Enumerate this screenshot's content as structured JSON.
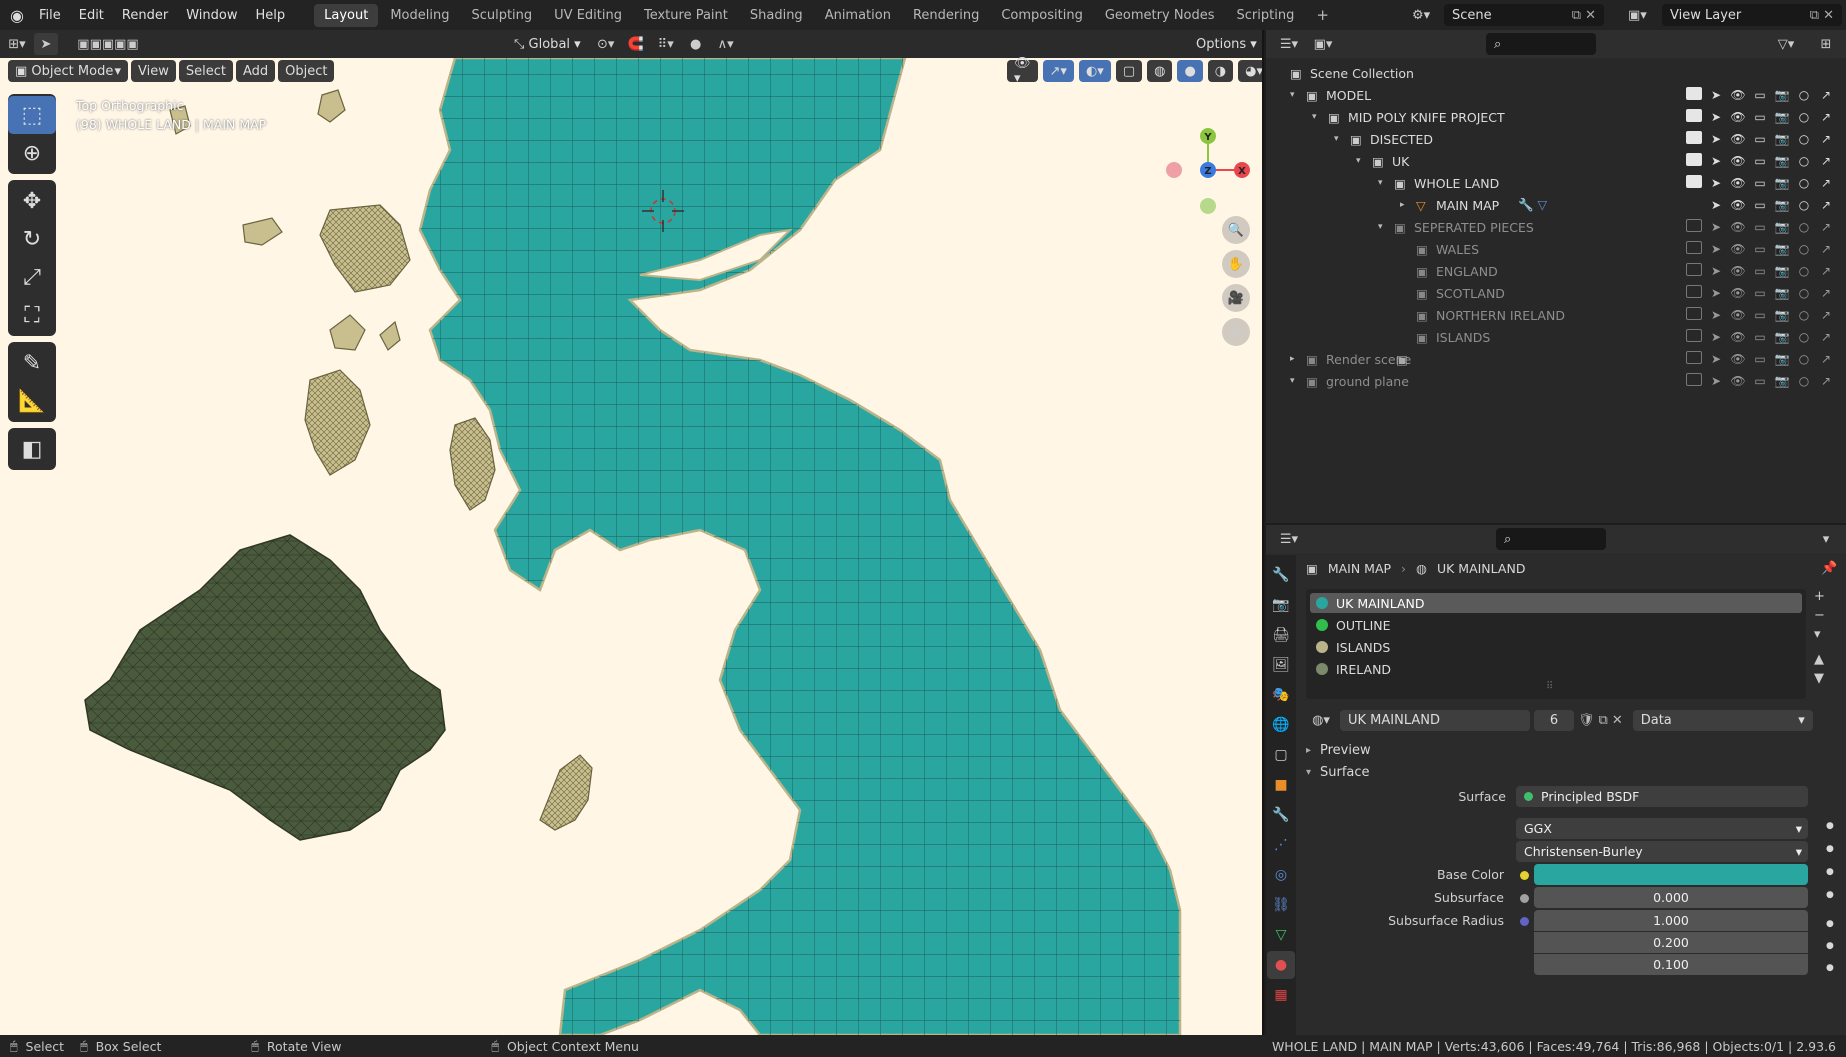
{
  "menu": {
    "items": [
      "File",
      "Edit",
      "Render",
      "Window",
      "Help"
    ]
  },
  "workspaces": [
    "Layout",
    "Modeling",
    "Sculpting",
    "UV Editing",
    "Texture Paint",
    "Shading",
    "Animation",
    "Rendering",
    "Compositing",
    "Geometry Nodes",
    "Scripting"
  ],
  "active_workspace": "Layout",
  "scene": {
    "label": "Scene",
    "view_layer": "View Layer"
  },
  "viewport": {
    "mode": "Object Mode",
    "menus": [
      "View",
      "Select",
      "Add",
      "Object"
    ],
    "transform_orientation": "Global",
    "options_label": "Options",
    "overlay_text_1": "Top Orthographic",
    "overlay_text_2": "(98) WHOLE LAND | MAIN MAP",
    "gizmo_axes": {
      "y": "Y",
      "z": "Z",
      "x": "X"
    }
  },
  "outliner": {
    "root": "Scene Collection",
    "rows": [
      {
        "label": "MODEL",
        "level": 1,
        "checked": true,
        "dim": false
      },
      {
        "label": "MID POLY KNIFE PROJECT",
        "level": 2,
        "checked": true,
        "dim": false
      },
      {
        "label": "DISECTED",
        "level": 3,
        "checked": true,
        "dim": false
      },
      {
        "label": "UK",
        "level": 4,
        "checked": true,
        "dim": false
      },
      {
        "label": "WHOLE LAND",
        "level": 5,
        "checked": true,
        "dim": false
      },
      {
        "label": "MAIN MAP",
        "level": 6,
        "checked": null,
        "dim": false
      },
      {
        "label": "SEPERATED PIECES",
        "level": 5,
        "checked": false,
        "dim": true
      },
      {
        "label": "WALES",
        "level": 6,
        "checked": false,
        "dim": true
      },
      {
        "label": "ENGLAND",
        "level": 6,
        "checked": false,
        "dim": true
      },
      {
        "label": "SCOTLAND",
        "level": 6,
        "checked": false,
        "dim": true
      },
      {
        "label": "NORTHERN IRELAND",
        "level": 6,
        "checked": false,
        "dim": true
      },
      {
        "label": "ISLANDS",
        "level": 6,
        "checked": false,
        "dim": true
      },
      {
        "label": "Render scene",
        "level": 1,
        "checked": false,
        "dim": true
      },
      {
        "label": "ground plane",
        "level": 1,
        "checked": false,
        "dim": true
      }
    ]
  },
  "properties": {
    "breadcrumb_object": "MAIN MAP",
    "breadcrumb_material": "UK MAINLAND",
    "material_slots": [
      {
        "name": "UK MAINLAND",
        "color": "#2aa6a0",
        "selected": true
      },
      {
        "name": "OUTLINE",
        "color": "#2fbf4a",
        "selected": false
      },
      {
        "name": "ISLANDS",
        "color": "#b9b48a",
        "selected": false
      },
      {
        "name": "IRELAND",
        "color": "#7a8a6a",
        "selected": false
      }
    ],
    "material_name": "UK MAINLAND",
    "users": "6",
    "link": "Data",
    "panel_preview": "Preview",
    "panel_surface": "Surface",
    "surface_label": "Surface",
    "surface_value": "Principled BSDF",
    "distribution": "GGX",
    "subsurface_method": "Christensen-Burley",
    "base_color_label": "Base Color",
    "base_color": "#2aa6a0",
    "subsurface_label": "Subsurface",
    "subsurface_value": "0.000",
    "subsurface_radius_label": "Subsurface Radius",
    "subsurface_radius": [
      "1.000",
      "0.200",
      "0.100"
    ]
  },
  "status": {
    "select": "Select",
    "box_select": "Box Select",
    "rotate": "Rotate View",
    "context": "Object Context Menu",
    "stats": "WHOLE LAND | MAIN MAP | Verts:43,606 | Faces:49,764 | Tris:86,968 | Objects:0/1 | 2.93.6"
  }
}
